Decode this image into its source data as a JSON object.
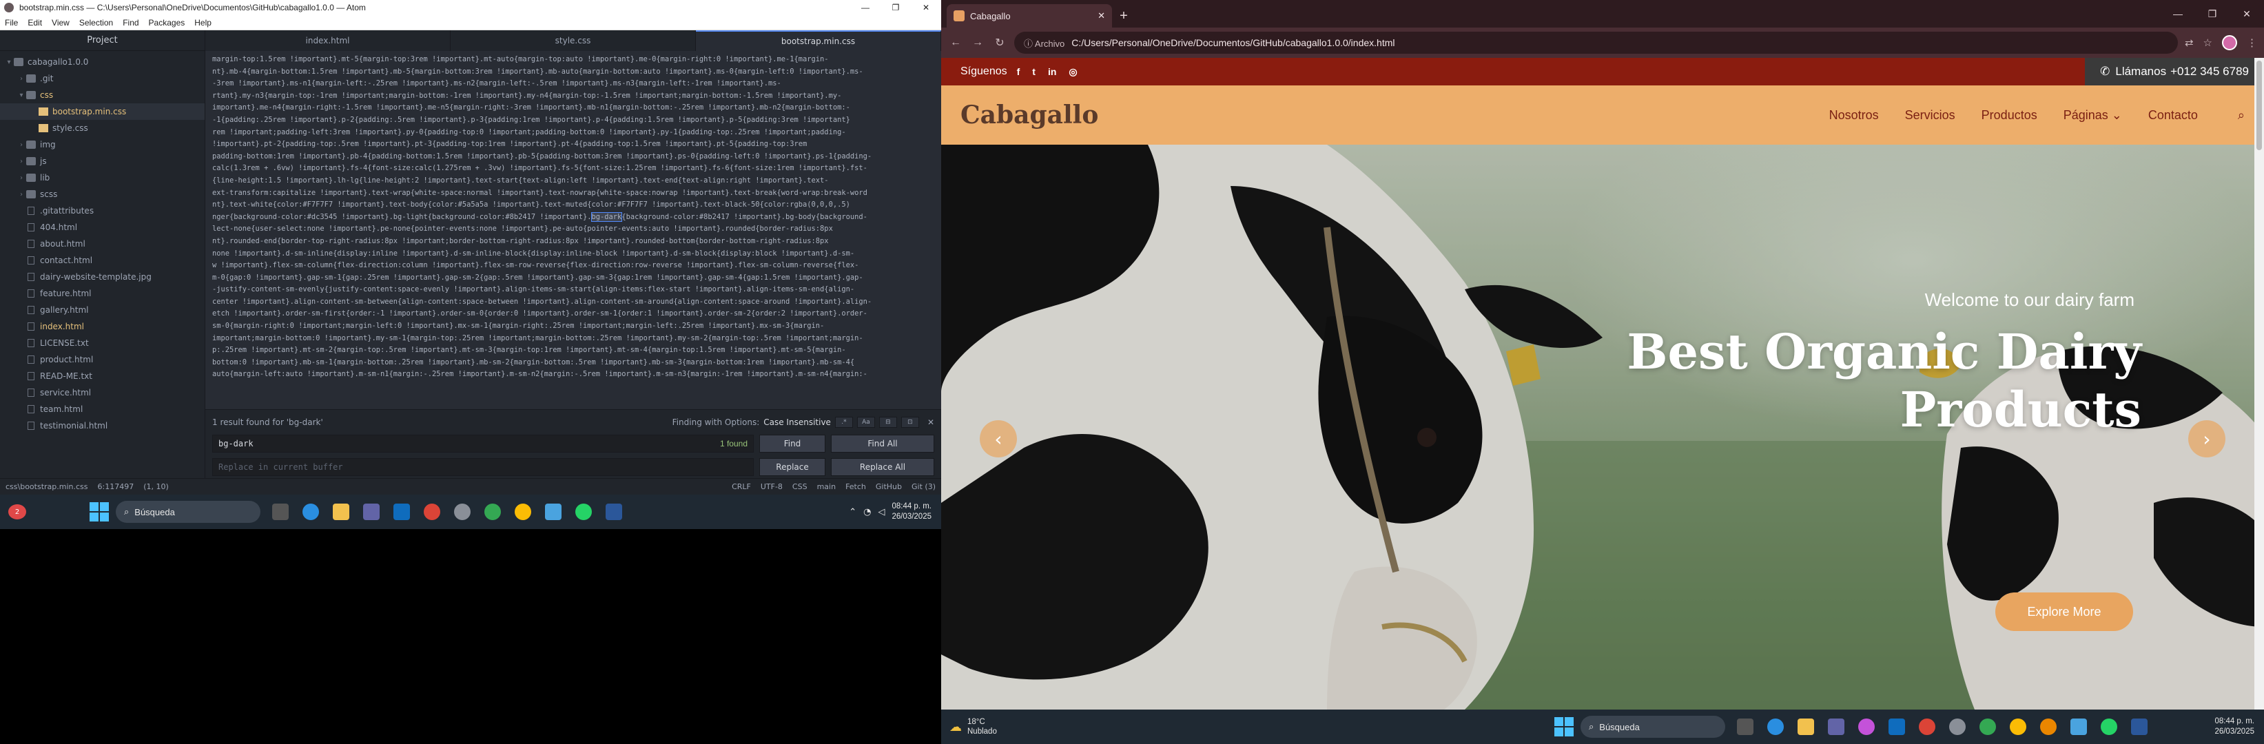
{
  "atom": {
    "title": "bootstrap.min.css — C:\\Users\\Personal\\OneDrive\\Documentos\\GitHub\\cabagallo1.0.0 — Atom",
    "menu": [
      "File",
      "Edit",
      "View",
      "Selection",
      "Find",
      "Packages",
      "Help"
    ],
    "window_buttons": [
      "—",
      "❐",
      "✕"
    ],
    "tree_header": "Project",
    "tree": [
      {
        "label": "cabagallo1.0.0",
        "kind": "folder",
        "arrow": "▾",
        "depth": 0
      },
      {
        "label": ".git",
        "kind": "folder",
        "arrow": "›",
        "depth": 1
      },
      {
        "label": "css",
        "kind": "folder",
        "arrow": "▾",
        "depth": 1,
        "modified": true
      },
      {
        "label": "bootstrap.min.css",
        "kind": "css",
        "arrow": "",
        "depth": 2,
        "selected": true,
        "modified": true
      },
      {
        "label": "style.css",
        "kind": "css",
        "arrow": "",
        "depth": 2
      },
      {
        "label": "img",
        "kind": "folder",
        "arrow": "›",
        "depth": 1
      },
      {
        "label": "js",
        "kind": "folder",
        "arrow": "›",
        "depth": 1
      },
      {
        "label": "lib",
        "kind": "folder",
        "arrow": "›",
        "depth": 1
      },
      {
        "label": "scss",
        "kind": "folder",
        "arrow": "›",
        "depth": 1
      },
      {
        "label": ".gitattributes",
        "kind": "file",
        "arrow": "",
        "depth": 1
      },
      {
        "label": "404.html",
        "kind": "file",
        "arrow": "",
        "depth": 1
      },
      {
        "label": "about.html",
        "kind": "file",
        "arrow": "",
        "depth": 1
      },
      {
        "label": "contact.html",
        "kind": "file",
        "arrow": "",
        "depth": 1
      },
      {
        "label": "dairy-website-template.jpg",
        "kind": "file",
        "arrow": "",
        "depth": 1
      },
      {
        "label": "feature.html",
        "kind": "file",
        "arrow": "",
        "depth": 1
      },
      {
        "label": "gallery.html",
        "kind": "file",
        "arrow": "",
        "depth": 1
      },
      {
        "label": "index.html",
        "kind": "file",
        "arrow": "",
        "depth": 1,
        "modified": true
      },
      {
        "label": "LICENSE.txt",
        "kind": "file",
        "arrow": "",
        "depth": 1
      },
      {
        "label": "product.html",
        "kind": "file",
        "arrow": "",
        "depth": 1
      },
      {
        "label": "READ-ME.txt",
        "kind": "file",
        "arrow": "",
        "depth": 1
      },
      {
        "label": "service.html",
        "kind": "file",
        "arrow": "",
        "depth": 1
      },
      {
        "label": "team.html",
        "kind": "file",
        "arrow": "",
        "depth": 1
      },
      {
        "label": "testimonial.html",
        "kind": "file",
        "arrow": "",
        "depth": 1
      }
    ],
    "tabs": [
      {
        "label": "index.html",
        "active": false
      },
      {
        "label": "style.css",
        "active": false
      },
      {
        "label": "bootstrap.min.css",
        "active": true
      }
    ],
    "code_lines": [
      "margin-top:1.5rem !important}.mt-5{margin-top:3rem !important}.mt-auto{margin-top:auto !important}.me-0{margin-right:0 !important}.me-1{margin-",
      "nt}.mb-4{margin-bottom:1.5rem !important}.mb-5{margin-bottom:3rem !important}.mb-auto{margin-bottom:auto !important}.ms-0{margin-left:0 !important}.ms-",
      "-3rem !important}.ms-n1{margin-left:-.25rem !important}.ms-n2{margin-left:-.5rem !important}.ms-n3{margin-left:-1rem !important}.ms-",
      "rtant}.my-n3{margin-top:-1rem !important;margin-bottom:-1rem !important}.my-n4{margin-top:-1.5rem !important;margin-bottom:-1.5rem !important}.my-",
      "important}.me-n4{margin-right:-1.5rem !important}.me-n5{margin-right:-3rem !important}.mb-n1{margin-bottom:-.25rem !important}.mb-n2{margin-bottom:-",
      "-1{padding:.25rem !important}.p-2{padding:.5rem !important}.p-3{padding:1rem !important}.p-4{padding:1.5rem !important}.p-5{padding:3rem !important}",
      "rem !important;padding-left:3rem !important}.py-0{padding-top:0 !important;padding-bottom:0 !important}.py-1{padding-top:.25rem !important;padding-",
      "!important}.pt-2{padding-top:.5rem !important}.pt-3{padding-top:1rem !important}.pt-4{padding-top:1.5rem !important}.pt-5{padding-top:3rem",
      "padding-bottom:1rem !important}.pb-4{padding-bottom:1.5rem !important}.pb-5{padding-bottom:3rem !important}.ps-0{padding-left:0 !important}.ps-1{padding-",
      "calc(1.3rem + .6vw) !important}.fs-4{font-size:calc(1.275rem + .3vw) !important}.fs-5{font-size:1.25rem !important}.fs-6{font-size:1rem !important}.fst-",
      "{line-height:1.5 !important}.lh-lg{line-height:2 !important}.text-start{text-align:left !important}.text-end{text-align:right !important}.text-",
      "ext-transform:capitalize !important}.text-wrap{white-space:normal !important}.text-nowrap{white-space:nowrap !important}.text-break{word-wrap:break-word",
      "nt}.text-white{color:#F7F7F7 !important}.text-body{color:#5a5a5a !important}.text-muted{color:#F7F7F7 !important}.text-black-50{color:rgba(0,0,0,.5)",
      "nger{background-color:#dc3545 !important}.bg-light{background-color:#8b2417 !important}.bg-dark{background-color:#8b2417 !important}.bg-body{background-",
      "lect-none{user-select:none !important}.pe-none{pointer-events:none !important}.pe-auto{pointer-events:auto !important}.rounded{border-radius:8px",
      "nt}.rounded-end{border-top-right-radius:8px !important;border-bottom-right-radius:8px !important}.rounded-bottom{border-bottom-right-radius:8px",
      "none !important}.d-sm-inline{display:inline !important}.d-sm-inline-block{display:inline-block !important}.d-sm-block{display:block !important}.d-sm-",
      "w !important}.flex-sm-column{flex-direction:column !important}.flex-sm-row-reverse{flex-direction:row-reverse !important}.flex-sm-column-reverse{flex-",
      "m-0{gap:0 !important}.gap-sm-1{gap:.25rem !important}.gap-sm-2{gap:.5rem !important}.gap-sm-3{gap:1rem !important}.gap-sm-4{gap:1.5rem !important}.gap-",
      "-justify-content-sm-evenly{justify-content:space-evenly !important}.align-items-sm-start{align-items:flex-start !important}.align-items-sm-end{align-",
      "center !important}.align-content-sm-between{align-content:space-between !important}.align-content-sm-around{align-content:space-around !important}.align-",
      "etch !important}.order-sm-first{order:-1 !important}.order-sm-0{order:0 !important}.order-sm-1{order:1 !important}.order-sm-2{order:2 !important}.order-",
      "sm-0{margin-right:0 !important;margin-left:0 !important}.mx-sm-1{margin-right:.25rem !important;margin-left:.25rem !important}.mx-sm-3{margin-",
      "important;margin-bottom:0 !important}.my-sm-1{margin-top:.25rem !important;margin-bottom:.25rem !important}.my-sm-2{margin-top:.5rem !important;margin-",
      "p:.25rem !important}.mt-sm-2{margin-top:.5rem !important}.mt-sm-3{margin-top:1rem !important}.mt-sm-4{margin-top:1.5rem !important}.mt-sm-5{margin-",
      "bottom:0 !important}.mb-sm-1{margin-bottom:.25rem !important}.mb-sm-2{margin-bottom:.5rem !important}.mb-sm-3{margin-bottom:1rem !important}.mb-sm-4{",
      "auto{margin-left:auto !important}.m-sm-n1{margin:-.25rem !important}.m-sm-n2{margin:-.5rem !important}.m-sm-n3{margin:-1rem !important}.m-sm-n4{margin:-"
    ],
    "find": {
      "result_text": "1 result found for 'bg-dark'",
      "options_text": "Finding with Options:",
      "options_value": "Case Insensitive",
      "option_icons": [
        ".*",
        "Aa",
        "⊟",
        "⊡"
      ],
      "close": "✕",
      "query": "bg-dark",
      "count": "1 found",
      "find_label": "Find",
      "find_all_label": "Find All",
      "replace_placeholder": "Replace in current buffer",
      "replace_label": "Replace",
      "replace_all_label": "Replace All"
    },
    "status": {
      "path": "css\\bootstrap.min.css",
      "cursor": "6:117497",
      "selection": "(1, 10)",
      "line_ending": "CRLF",
      "encoding": "UTF-8",
      "grammar": "CSS",
      "branch": "main",
      "fetch": "Fetch",
      "github": "GitHub",
      "git": "Git (3)"
    }
  },
  "taskbar_left": {
    "search_label": "Búsqueda",
    "time": "08:44 p. m.",
    "date": "26/03/2025",
    "notif_count": "2"
  },
  "browser": {
    "tab_title": "Cabagallo",
    "tab_close": "✕",
    "new_tab": "+",
    "window_buttons": [
      "—",
      "❐",
      "✕"
    ],
    "url_chip": "Archivo",
    "url": "C:/Users/Personal/OneDrive/Documentos/GitHub/cabagallo1.0.0/index.html"
  },
  "site": {
    "follow_label": "Síguenos",
    "social_icons": [
      "f",
      "t",
      "in",
      "◎"
    ],
    "call_label": "Llámanos",
    "phone": "+012 345 6789",
    "brand": "Cabagallo",
    "nav": [
      "Nosotros",
      "Servicios",
      "Productos",
      "Páginas ⌄",
      "Contacto"
    ],
    "welcome": "Welcome to our dairy farm",
    "title_line1": "Best Organic Dairy",
    "title_line2": "Products",
    "cta": "Explore More",
    "prev": "‹",
    "next": "›",
    "colors": {
      "topbar": "#8a1c0f",
      "navbar": "#edae6b",
      "accent": "#e8a560"
    }
  },
  "taskbar_right": {
    "temperature": "18°C",
    "weather": "Nublado",
    "search_label": "Búsqueda",
    "time": "08:44 p. m.",
    "date": "26/03/2025"
  }
}
